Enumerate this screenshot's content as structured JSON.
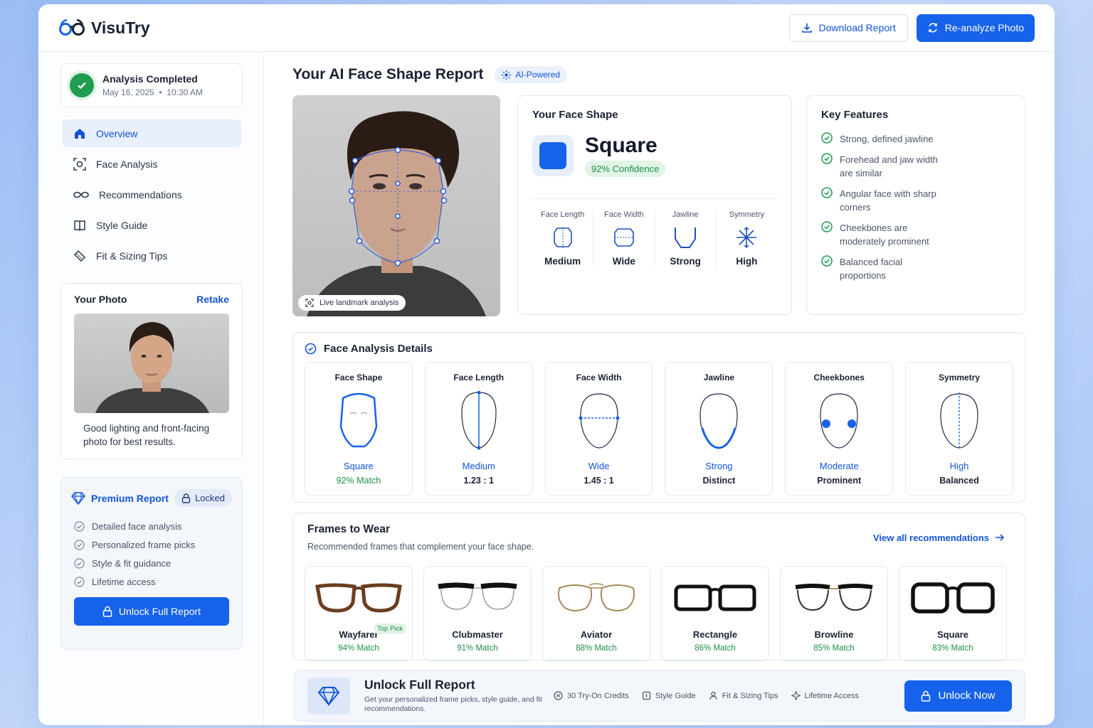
{
  "app": {
    "name": "VisuTry"
  },
  "toolbar": {
    "download_label": "Download Report",
    "reanalyze_label": "Re-analyze Photo"
  },
  "status": {
    "title": "Analysis Completed",
    "date": "May 16, 2025",
    "time": "10:30 AM"
  },
  "sidebar": {
    "items": [
      {
        "label": "Overview",
        "icon": "home-icon"
      },
      {
        "label": "Face Analysis",
        "icon": "scan-face-icon"
      },
      {
        "label": "Recommendations",
        "icon": "glasses-icon"
      },
      {
        "label": "Style Guide",
        "icon": "book-icon"
      },
      {
        "label": "Fit & Sizing Tips",
        "icon": "ruler-icon"
      }
    ]
  },
  "photo_card": {
    "title": "Your Photo",
    "retake": "Retake",
    "tip": "Good lighting and front-facing photo for best results."
  },
  "premium": {
    "title": "Premium Report",
    "locked": "Locked",
    "items": [
      "Detailed face analysis",
      "Personalized frame picks",
      "Style & fit guidance",
      "Lifetime access"
    ],
    "button": "Unlock Full Report"
  },
  "report": {
    "title": "Your AI Face Shape Report",
    "badge": "AI-Powered",
    "live_label": "Live landmark analysis"
  },
  "face_shape": {
    "title": "Your Face Shape",
    "name": "Square",
    "confidence": "92% Confidence",
    "metrics": [
      {
        "label": "Face Length",
        "value": "Medium"
      },
      {
        "label": "Face Width",
        "value": "Wide"
      },
      {
        "label": "Jawline",
        "value": "Strong"
      },
      {
        "label": "Symmetry",
        "value": "High"
      }
    ]
  },
  "key_features": {
    "title": "Key Features",
    "items": [
      "Strong, defined jawline",
      "Forehead and jaw width are similar",
      "Angular face with sharp corners",
      "Cheekbones are moderately prominent",
      "Balanced facial proportions"
    ]
  },
  "details": {
    "title": "Face Analysis Details",
    "items": [
      {
        "label": "Face Shape",
        "value": "Square",
        "sub": "92% Match"
      },
      {
        "label": "Face Length",
        "value": "Medium",
        "sub": "1.23 : 1"
      },
      {
        "label": "Face Width",
        "value": "Wide",
        "sub": "1.45 : 1"
      },
      {
        "label": "Jawline",
        "value": "Strong",
        "sub": "Distinct"
      },
      {
        "label": "Cheekbones",
        "value": "Moderate",
        "sub": "Prominent"
      },
      {
        "label": "Symmetry",
        "value": "High",
        "sub": "Balanced"
      }
    ]
  },
  "frames": {
    "title": "Frames to Wear",
    "subtitle": "Recommended frames that complement your face shape.",
    "view_all": "View all recommendations",
    "top_pick": "Top Pick",
    "items": [
      {
        "name": "Wayfarer",
        "match": "94% Match"
      },
      {
        "name": "Clubmaster",
        "match": "91% Match"
      },
      {
        "name": "Aviator",
        "match": "88% Match"
      },
      {
        "name": "Rectangle",
        "match": "86% Match"
      },
      {
        "name": "Browline",
        "match": "85% Match"
      },
      {
        "name": "Square",
        "match": "83% Match"
      }
    ]
  },
  "banner": {
    "title": "Unlock Full Report",
    "subtitle": "Get your personalized frame picks, style guide, and fit recommendations.",
    "features": [
      "30 Try-On Credits",
      "Style Guide",
      "Fit & Sizing Tips",
      "Lifetime Access"
    ],
    "button": "Unlock Now"
  },
  "colors": {
    "accent": "#1662ea",
    "success": "#1f9c50"
  }
}
